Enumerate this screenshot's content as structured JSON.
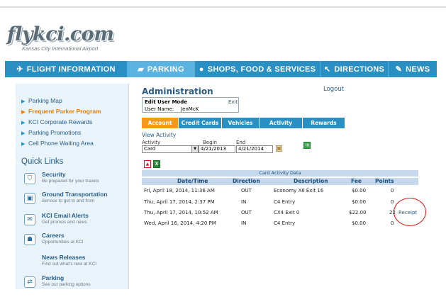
{
  "brand": {
    "logo_text": "flykci.com",
    "tagline": "Kansas City International Airport"
  },
  "nav": [
    {
      "label": "FLIGHT INFORMATION",
      "icon": "airplane-icon"
    },
    {
      "label": "PARKING",
      "icon": "car-icon"
    },
    {
      "label": "SHOPS, FOOD & SERVICES",
      "icon": "shopping-bag-icon"
    },
    {
      "label": "DIRECTIONS",
      "icon": "arrow-icon"
    },
    {
      "label": "NEWS",
      "icon": "pen-icon"
    }
  ],
  "sidebar": {
    "links": [
      {
        "label": "Parking Map"
      },
      {
        "label": "Frequent Parker Program"
      },
      {
        "label": "KCI Corporate Rewards"
      },
      {
        "label": "Parking Promotions"
      },
      {
        "label": "Cell Phone Waiting Area"
      }
    ],
    "quick_links_title": "Quick Links",
    "quick_links": [
      {
        "title": "Security",
        "subtitle": "Be prepared for your travels",
        "icon": "shield-icon"
      },
      {
        "title": "Ground Transportation",
        "subtitle": "Service to get to and from",
        "icon": "bus-icon"
      },
      {
        "title": "KCI Email Alerts",
        "subtitle": "Get promos and news",
        "icon": "envelope-icon"
      },
      {
        "title": "Careers",
        "subtitle": "Opportunities at KCI",
        "icon": "person-icon"
      },
      {
        "title": "News Releases",
        "subtitle": "Find out what's new at KCI",
        "icon": ""
      },
      {
        "title": "Parking",
        "subtitle": "See our parking options",
        "icon": "parking-sign-icon"
      }
    ]
  },
  "admin": {
    "title": "Administration",
    "logout": "Logout",
    "edit_mode_label": "Edit User Mode",
    "exit_label": "Exit",
    "username_label": "User Name:",
    "username_value": "JenMcK"
  },
  "tabs": [
    "Account",
    "Credit Cards",
    "Vehicles",
    "Activity",
    "Rewards"
  ],
  "view_activity": {
    "title": "View Activity",
    "activity_label": "Activity",
    "activity_value": "Card",
    "begin_label": "Begin",
    "begin_value": "4/21/2013",
    "end_label": "End",
    "end_value": "4/21/2014"
  },
  "table": {
    "title": "Card Activity Data",
    "columns": [
      "Date/Time",
      "Direction",
      "Description",
      "Fee",
      "Points"
    ],
    "rows": [
      {
        "datetime": "Fri, April 18, 2014, 11:36 AM",
        "direction": "OUT",
        "description": "Economy X6 Exit 16",
        "fee": "$0.00",
        "points": "0",
        "link": ""
      },
      {
        "datetime": "Thu, April 17, 2014, 2:37 PM",
        "direction": "IN",
        "description": "C4 Entry",
        "fee": "$0.00",
        "points": "0",
        "link": ""
      },
      {
        "datetime": "Thu, April 17, 2014, 10:52 AM",
        "direction": "OUT",
        "description": "CX4 Exit 0",
        "fee": "$22.00",
        "points": "22",
        "link": "Receipt"
      },
      {
        "datetime": "Wed, April 16, 2014, 4:20 PM",
        "direction": "IN",
        "description": "C4 Entry",
        "fee": "$0.00",
        "points": "0",
        "link": ""
      }
    ]
  },
  "colors": {
    "nav_blue": "#2a8fc3",
    "active_tab_orange": "#f39a1d",
    "annotation_red": "#d61b1b"
  }
}
